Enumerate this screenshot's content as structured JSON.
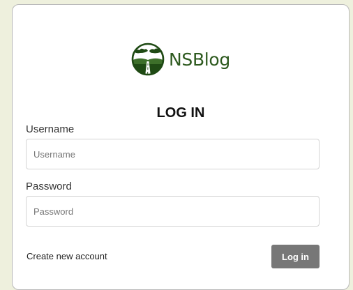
{
  "brand": {
    "name": "NSBlog",
    "logo_icon": "road-landscape-logo-icon",
    "color": "#2e5a1f"
  },
  "form": {
    "title": "LOG IN",
    "username_label": "Username",
    "username_placeholder": "Username",
    "username_value": "",
    "password_label": "Password",
    "password_placeholder": "Password",
    "password_value": ""
  },
  "actions": {
    "create_account": "Create new account",
    "login": "Log in",
    "login_color": "#777777"
  }
}
